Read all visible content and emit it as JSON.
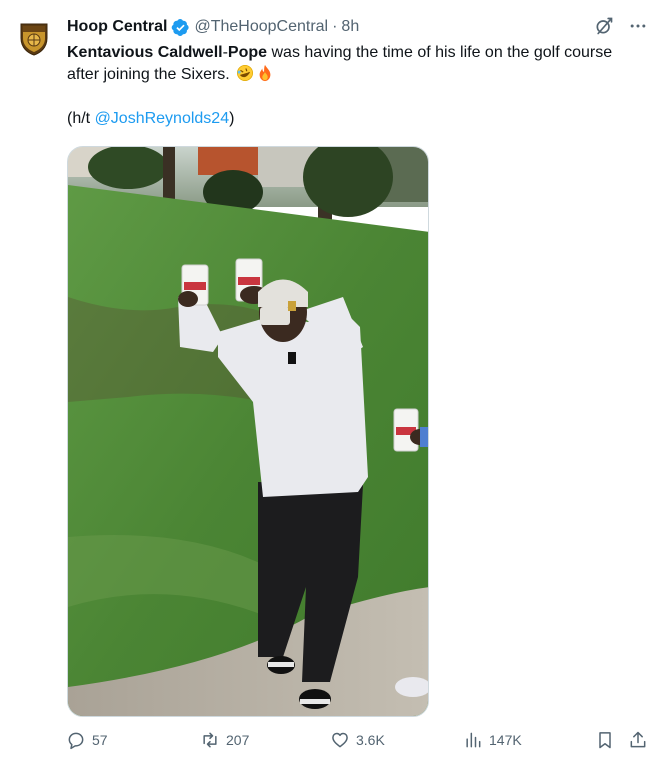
{
  "account": {
    "display_name": "Hoop Central",
    "handle": "@TheHoopCentral",
    "separator": "·",
    "time": "8h",
    "verified": true
  },
  "tweet": {
    "name_part1": "Kentavious Caldwell",
    "name_dash": "-",
    "name_part2": "Pope",
    "body": " was having the time of his life on the golf course after joining the Sixers. ",
    "emojis": [
      "rolling-laughing-emoji",
      "fire-emoji"
    ],
    "ht_prefix": "(h/t ",
    "ht_mention": "@JoshReynolds24",
    "ht_suffix": ")"
  },
  "media": {
    "type": "video-still",
    "description_icon": "video-frame"
  },
  "actions": {
    "replies": "57",
    "reposts": "207",
    "likes": "3.6K",
    "views": "147K"
  },
  "colors": {
    "accent": "#1d9bf0",
    "text": "#0f1419",
    "secondary": "#536471",
    "grass": "#4f8a3a"
  }
}
